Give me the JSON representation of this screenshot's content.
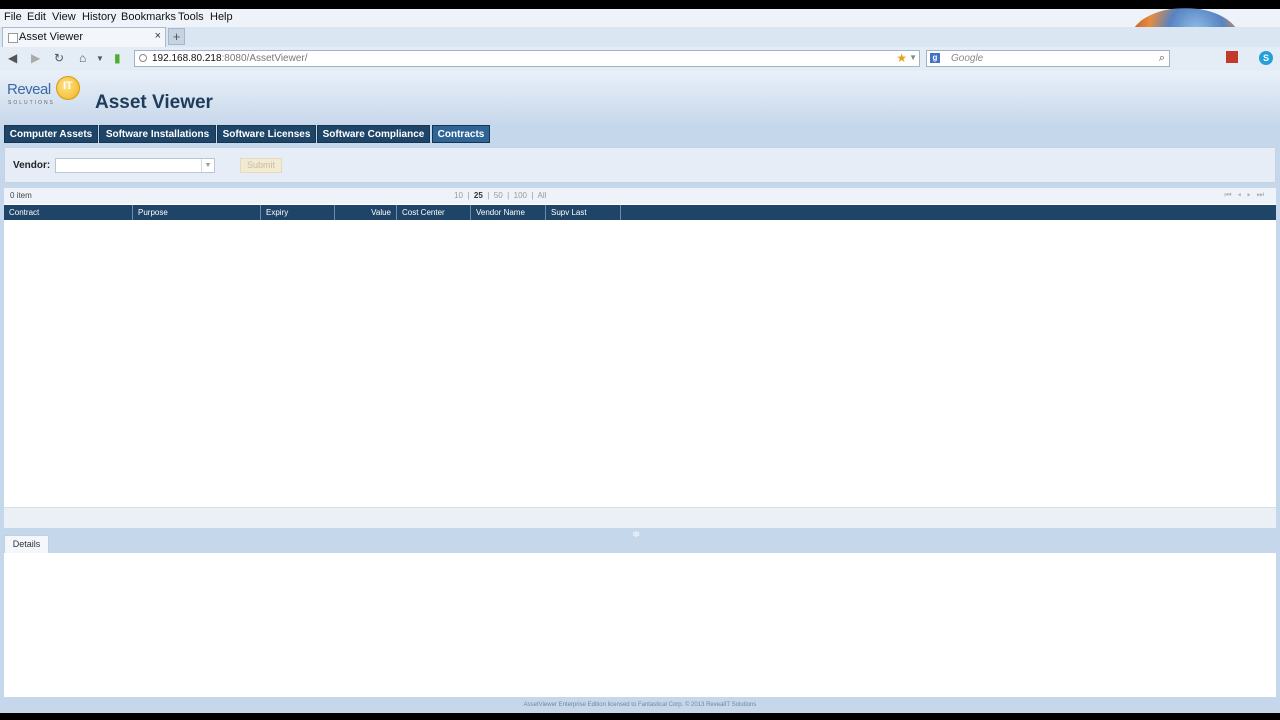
{
  "browser": {
    "menu": [
      "File",
      "Edit",
      "View",
      "History",
      "Bookmarks",
      "Tools",
      "Help"
    ],
    "tab_title": "Asset Viewer",
    "new_tab": "+",
    "url_host": "192.168.80.218",
    "url_path": ":8080/AssetViewer/",
    "search_placeholder": "Google"
  },
  "app": {
    "logo_text": "Reveal",
    "logo_sub": "SOLUTIONS",
    "logo_mark": "IT",
    "title": "Asset Viewer",
    "tabs": [
      {
        "label": "Computer Assets"
      },
      {
        "label": "Software Installations"
      },
      {
        "label": "Software Licenses"
      },
      {
        "label": "Software Compliance"
      },
      {
        "label": "Contracts",
        "active": true
      }
    ],
    "filter": {
      "vendor_label": "Vendor:",
      "vendor_value": "",
      "submit_label": "Submit"
    },
    "grid": {
      "count": "0 item",
      "page_sizes": [
        "10",
        "25",
        "50",
        "100",
        "All"
      ],
      "selected_page_size": "25",
      "columns": [
        "Contract",
        "Purpose",
        "Expiry",
        "Value",
        "Cost Center",
        "Vendor Name",
        "Supv Last"
      ]
    },
    "details_tab": "Details",
    "footer": "AssetViewer Enterprise Edition licensed to Fantastical Corp.  © 2013 RevealIT Solutions"
  }
}
